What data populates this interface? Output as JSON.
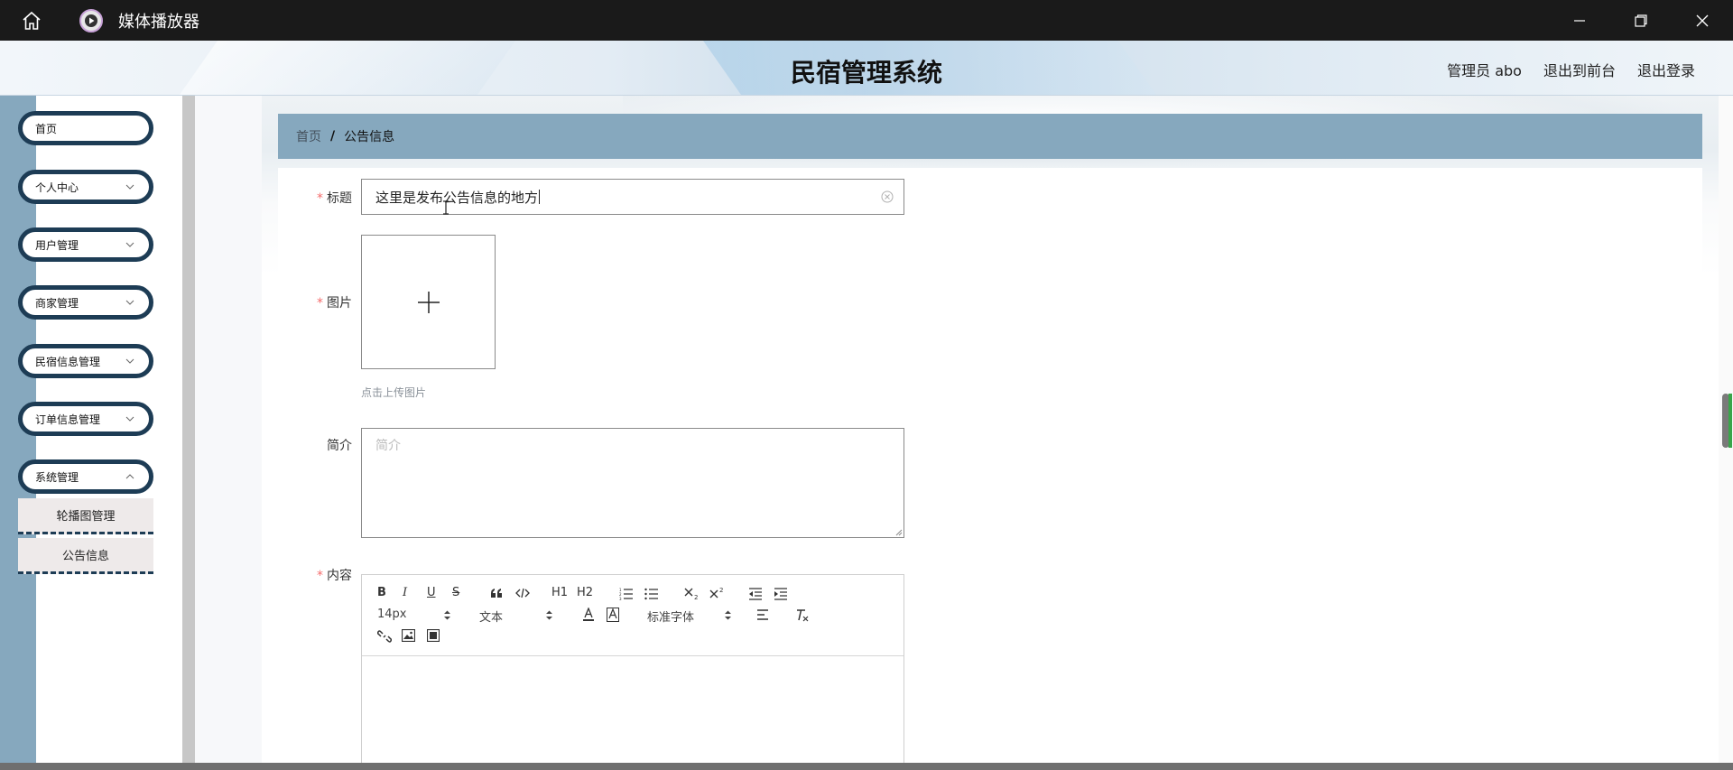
{
  "window": {
    "title": "媒体播放器",
    "icons": [
      "home-icon",
      "play-icon",
      "minimize-icon",
      "restore-icon",
      "close-icon"
    ]
  },
  "header": {
    "title": "民宿管理系统",
    "user_label": "管理员 abo",
    "back_to_front": "退出到前台",
    "logout": "退出登录"
  },
  "sidebar": {
    "items": [
      {
        "label": "首页"
      },
      {
        "label": "个人中心"
      },
      {
        "label": "用户管理"
      },
      {
        "label": "商家管理"
      },
      {
        "label": "民宿信息管理"
      },
      {
        "label": "订单信息管理"
      },
      {
        "label": "系统管理"
      }
    ],
    "submenu": [
      {
        "label": "轮播图管理"
      },
      {
        "label": "公告信息"
      }
    ]
  },
  "breadcrumb": {
    "home": "首页",
    "separator": "/",
    "current": "公告信息"
  },
  "form": {
    "title_label": "标题",
    "title_value": "这里是发布公告信息的地方",
    "image_label": "图片",
    "upload_tip": "点击上传图片",
    "intro_label": "简介",
    "intro_placeholder": "简介",
    "content_label": "内容",
    "required_mark": "*"
  },
  "editor": {
    "font_size": "14px",
    "paragraph": "文本",
    "font_family": "标准字体",
    "tools": [
      "B",
      "I",
      "U",
      "S"
    ],
    "heading1": "H1",
    "heading2": "H2"
  },
  "colors": {
    "accent": "#86a8be",
    "menu_border": "#1d3c55",
    "required": "#f56c6c"
  }
}
